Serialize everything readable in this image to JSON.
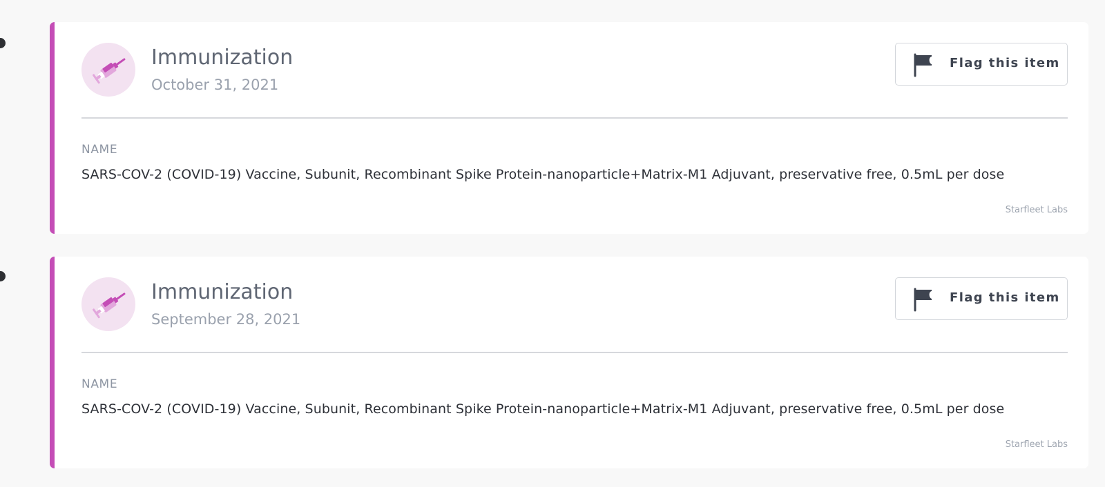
{
  "colors": {
    "accent": "#c44db6",
    "avatar_bg": "#f3e2f1",
    "timeline_dot": "#2d2f33"
  },
  "items": [
    {
      "icon": "syringe-icon",
      "title": "Immunization",
      "date": "October 31, 2021",
      "flag_label": "Flag this item",
      "field_label": "NAME",
      "field_value": "SARS-COV-2 (COVID-19) Vaccine, Subunit, Recombinant Spike Protein-nanoparticle+Matrix-M1 Adjuvant, preservative free, 0.5mL per dose",
      "source": "Starfleet Labs"
    },
    {
      "icon": "syringe-icon",
      "title": "Immunization",
      "date": "September 28, 2021",
      "flag_label": "Flag this item",
      "field_label": "NAME",
      "field_value": "SARS-COV-2 (COVID-19) Vaccine, Subunit, Recombinant Spike Protein-nanoparticle+Matrix-M1 Adjuvant, preservative free, 0.5mL per dose",
      "source": "Starfleet Labs"
    }
  ]
}
